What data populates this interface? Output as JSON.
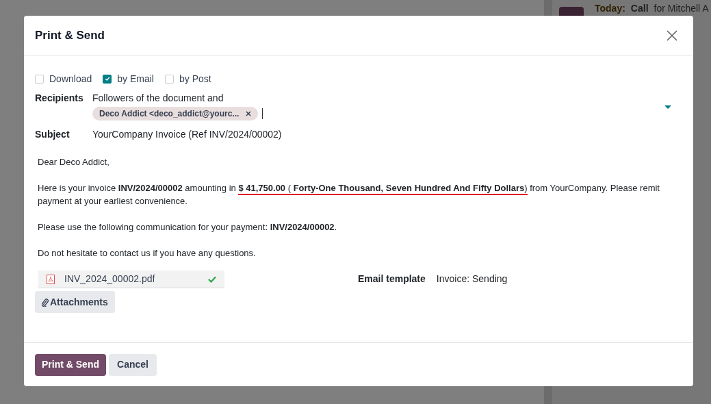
{
  "background": {
    "activity_day": "Today:",
    "activity_type": "Call",
    "activity_for": "for Mitchell A"
  },
  "dialog": {
    "title": "Print & Send",
    "options": [
      {
        "label": "Download",
        "checked": false
      },
      {
        "label": "by Email",
        "checked": true
      },
      {
        "label": "by Post",
        "checked": false
      }
    ],
    "recipients": {
      "label": "Recipients",
      "intro": "Followers of the document and",
      "tags": [
        "Deco Addict <deco_addict@yourc..."
      ]
    },
    "subject": {
      "label": "Subject",
      "value": "YourCompany Invoice (Ref INV/2024/00002)"
    },
    "body": {
      "greeting": "Dear Deco Addict,",
      "invoice_before": "Here is your invoice **INV/2024/00002** amounting in ",
      "invoice_marked": "**$ 41,750.00** ( **Forty-One Thousand, Seven Hundred And Fifty Dollars**)",
      "invoice_after": " from YourCompany. Please remit payment at your earliest convenience.",
      "communication": "Please use the following communication for your payment: **INV/2024/00002**.",
      "closing": "Do not hesitate to contact us if you have any questions."
    },
    "attachment_files": [
      {
        "name": "INV_2024_00002.pdf",
        "uploaded": true
      }
    ],
    "attachments_button": "Attachments",
    "email_template": {
      "label": "Email template",
      "value": "Invoice: Sending"
    },
    "buttons": [
      {
        "label": "Print & Send",
        "kind": "primary"
      },
      {
        "label": "Cancel",
        "kind": "secondary"
      }
    ]
  }
}
